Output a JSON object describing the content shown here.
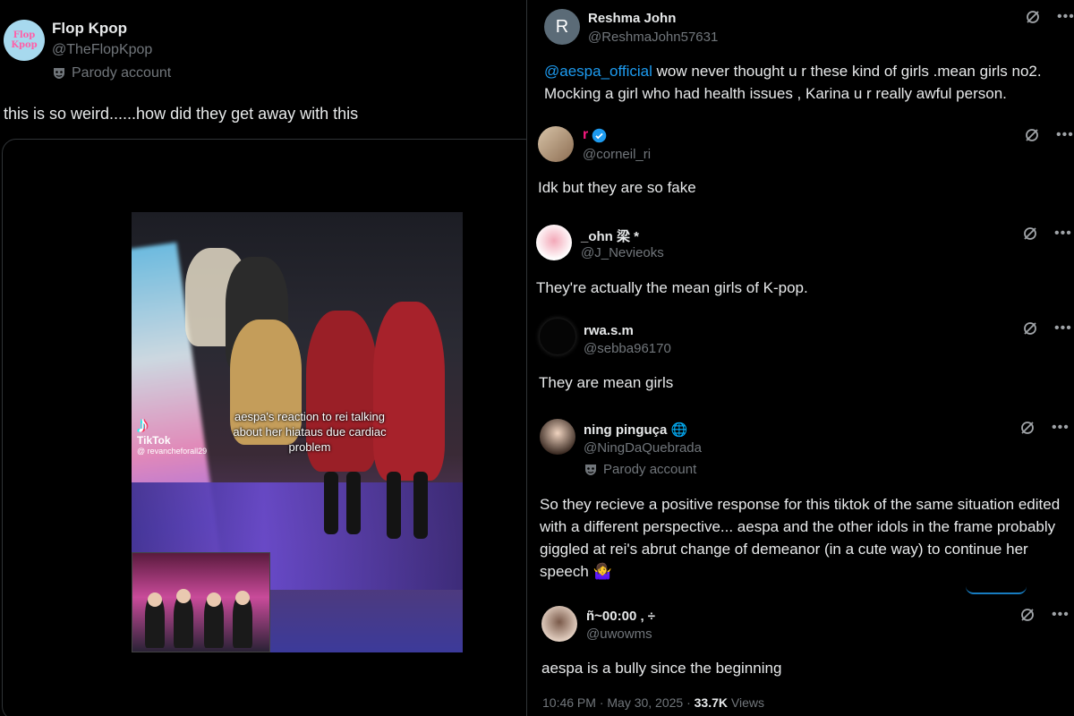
{
  "left_tweet": {
    "display_name": "Flop Kpop",
    "handle": "@TheFlopKpop",
    "parody_label": "Parody account",
    "avatar_text": [
      "Flop",
      "Kpop"
    ],
    "text": "this is so weird......how did they get away with this",
    "video": {
      "caption": "aespa's reaction to rei talking about her hiataus due cardiac problem",
      "watermark_app": "TikTok",
      "watermark_user": "@ revancheforall29"
    }
  },
  "replies": [
    {
      "display_name": "Reshma John",
      "handle": "@ReshmaJohn57631",
      "avatar_letter": "R",
      "mention": "@aespa_official",
      "text": " wow  never thought u r these kind of girls .mean girls no2. Mocking a girl who had health issues , Karina u r really awful person."
    },
    {
      "display_name": "r",
      "handle": "@corneil_ri",
      "verified": true,
      "text": "Idk but they are so fake"
    },
    {
      "display_name": "_ohn 梁 *",
      "handle": "@J_Nevieoks",
      "text": "They're actually the mean girls of K-pop."
    },
    {
      "display_name": "rwa.s.m",
      "handle": "@sebba96170",
      "text": "They are mean girls"
    },
    {
      "display_name": "ning pinguça 🌐",
      "handle": "@NingDaQuebrada",
      "parody_label": "Parody account",
      "text": "So they recieve a positive response for this tiktok of the same situation edited with a different perspective... aespa and the other idols in the frame probably giggled at rei's abrut change of demeanor (in a cute way) to continue her speech 🤷‍♀️"
    },
    {
      "display_name": "ñ~00:00 ‚ ÷",
      "handle": "@uwowms",
      "text": "aespa is a bully since the beginning"
    }
  ],
  "footer": {
    "timestamp": "10:46 PM · May 30, 2025 · ",
    "views_count": "33.7K",
    "views_label": " Views"
  },
  "colors": {
    "background": "#000000",
    "text": "#e7e9ea",
    "muted": "#71767b",
    "link": "#1d9bf0"
  },
  "icons": [
    "parody-mask-icon",
    "grok-icon",
    "more-icon",
    "verified-badge-icon"
  ]
}
